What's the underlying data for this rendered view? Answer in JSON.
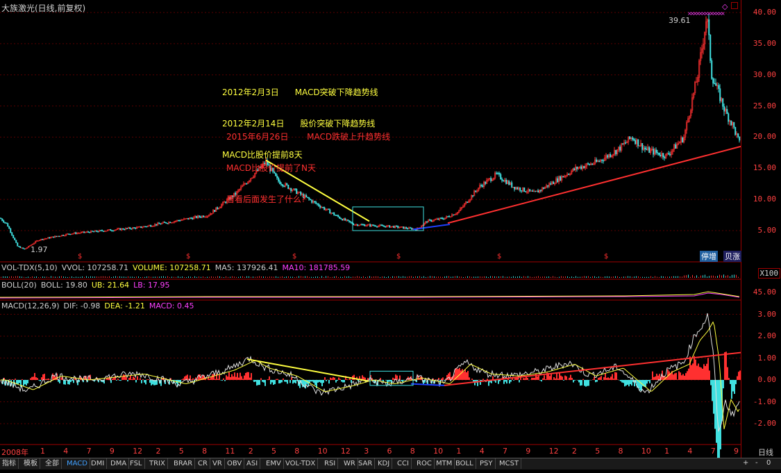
{
  "title": "大族激光(日线,前复权)",
  "main_axis": {
    "labels": [
      "40.00",
      "35.00",
      "30.00",
      "25.00",
      "20.00",
      "15.00",
      "10.00",
      "5.00"
    ],
    "values": [
      40,
      35,
      30,
      25,
      20,
      15,
      10,
      5
    ]
  },
  "price_high_label": "39.61",
  "price_low_label": "1.97",
  "annotation_yellow": [
    "2012年2月3日      MACD突破下降趋势线",
    "2012年2月14日      股价突破下降趋势线",
    "MACD比股价提前8天"
  ],
  "annotation_red": [
    "2015年6月26日       MACD跌破上升趋势线",
    "MACD比股价提前了N天",
    "看看后面发生了什么?"
  ],
  "badges": {
    "stop_add": "停增",
    "sell_rise": "贝涨"
  },
  "vol_legend": {
    "name": "VOL-TDX(5,10)",
    "vvol": "VVOL: 107258.71",
    "volume": "VOLUME: 107258.71",
    "ma5": "MA5: 137926.41",
    "ma10": "MA10: 181785.59",
    "scale": "X100"
  },
  "boll_legend": {
    "name": "BOLL(20)",
    "boll": "BOLL: 19.80",
    "ub": "UB: 21.64",
    "lb": "LB: 17.95",
    "axis": "45.00"
  },
  "macd_legend": {
    "name": "MACD(12,26,9)",
    "dif": "DIF: -0.98",
    "dea": "DEA: -1.21",
    "macd": "MACD: 0.45"
  },
  "macd_axis": {
    "labels": [
      "3.00",
      "2.00",
      "1.00",
      "0.00",
      "-1.00",
      "-2.00"
    ],
    "values": [
      3,
      2,
      1,
      0,
      -1,
      -2
    ]
  },
  "x_axis": {
    "year_label": "2008年",
    "ticks": [
      "1",
      "4",
      "7",
      "9",
      "12",
      "2",
      "5",
      "8",
      "11",
      "2",
      "5",
      "8",
      "10",
      "12",
      "3",
      "6",
      "8",
      "10",
      "1",
      "4",
      "7",
      "9",
      "12",
      "2",
      "5",
      "8",
      "10",
      "1",
      "4",
      "7",
      "9"
    ],
    "period": "日线"
  },
  "tabs": [
    "指标",
    "模板",
    "全部",
    "MACD",
    "DMI",
    "DMA",
    "FSL",
    "TRIX",
    "BRAR",
    "CR",
    "VR",
    "OBV",
    "ASI",
    "EMV",
    "VOL-TDX",
    "RSI",
    "WR",
    "SAR",
    "KDJ",
    "CCI",
    "ROC",
    "MTM",
    "BOLL",
    "PSY",
    "MCST"
  ],
  "active_tab": "MACD",
  "corner_buttons": [
    "+",
    "-",
    "0"
  ],
  "colors": {
    "up": "#ff3030",
    "down": "#40e0e0",
    "yellow": "#ffff40",
    "magenta": "#ff40ff",
    "axis": "#a00000",
    "blue": "#2040ff"
  }
}
